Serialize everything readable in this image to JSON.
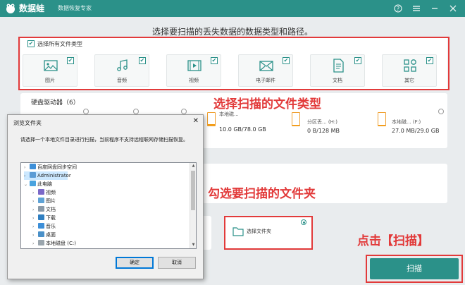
{
  "app": {
    "name": "数据蛙",
    "subtitle": "数据恢复专家"
  },
  "window_controls": [
    "help-icon",
    "menu-icon",
    "minimize-icon",
    "close-icon"
  ],
  "heading": "选择要扫描的丢失数据的数据类型和路径。",
  "select_all": {
    "label": "选择所有文件类型",
    "checked": true
  },
  "file_types": [
    {
      "label": "图片",
      "icon": "image-icon",
      "checked": true
    },
    {
      "label": "音频",
      "icon": "music-icon",
      "checked": true
    },
    {
      "label": "视频",
      "icon": "video-icon",
      "checked": true
    },
    {
      "label": "电子邮件",
      "icon": "email-icon",
      "checked": true
    },
    {
      "label": "文档",
      "icon": "document-icon",
      "checked": true
    },
    {
      "label": "其它",
      "icon": "other-icon",
      "checked": true
    }
  ],
  "annotations": {
    "file_types": "选择扫描的文件类型",
    "folder": "勾选要扫描的文件夹",
    "scan": "点击【扫描】"
  },
  "drives": {
    "title": "硬盘驱动器（6）",
    "items": [
      {
        "name": "本地磁...",
        "size": "10.0 GB/78.0 GB",
        "fill_fraction": 0.13
      },
      {
        "name": "分区丢... (H:)",
        "size": "0 B/128 MB",
        "fill_fraction": 0.0
      },
      {
        "name": "本地磁... (F:)",
        "size": "27.0 MB/29.0 GB",
        "fill_fraction": 0.05
      }
    ]
  },
  "dialog": {
    "title": "浏览文件夹",
    "close": "✕",
    "description": "请选择一个本地文件目录进行扫描，当前程序不支持远程联网存储扫描恢复。",
    "tree": [
      {
        "label": "百度网盘同步空间",
        "icon": "folder-icon",
        "level": 0,
        "expander": "›"
      },
      {
        "label": "Administrator",
        "icon": "user-icon",
        "level": 0,
        "expander": "›",
        "selected": true
      },
      {
        "label": "此电脑",
        "icon": "computer-icon",
        "level": 0,
        "expander": "⌄"
      },
      {
        "label": "视频",
        "icon": "video-folder-icon",
        "level": 1,
        "expander": "›"
      },
      {
        "label": "图片",
        "icon": "pictures-folder-icon",
        "level": 1,
        "expander": "›"
      },
      {
        "label": "文档",
        "icon": "documents-folder-icon",
        "level": 1,
        "expander": "›"
      },
      {
        "label": "下载",
        "icon": "download-folder-icon",
        "level": 1,
        "expander": "›"
      },
      {
        "label": "音乐",
        "icon": "music-folder-icon",
        "level": 1,
        "expander": "›"
      },
      {
        "label": "桌面",
        "icon": "desktop-folder-icon",
        "level": 1,
        "expander": "›"
      },
      {
        "label": "本地磁盘 (C:)",
        "icon": "drive-icon",
        "level": 1,
        "expander": "›"
      }
    ],
    "ok_label": "确定",
    "cancel_label": "取消"
  },
  "folder_option": {
    "label": "选择文件夹",
    "selected": true
  },
  "scan_button": {
    "label": "扫描"
  },
  "colors": {
    "accent": "#2b9189",
    "annotation": "#e23a3a",
    "drive_fill": "#f39c12"
  }
}
